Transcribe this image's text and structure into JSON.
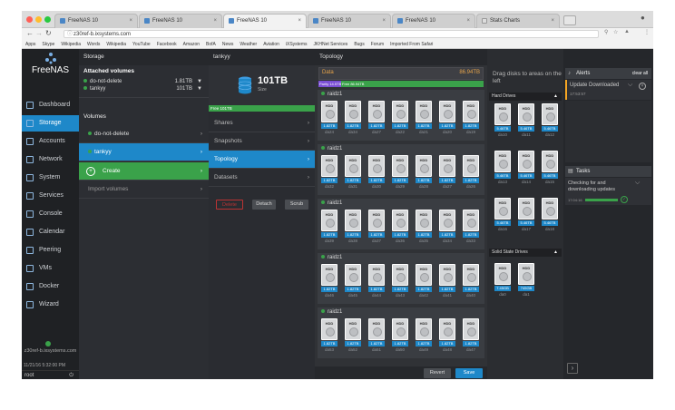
{
  "browser": {
    "tabs": [
      {
        "label": "FreeNAS 10"
      },
      {
        "label": "FreeNAS 10"
      },
      {
        "label": "FreeNAS 10"
      },
      {
        "label": "FreeNAS 10"
      },
      {
        "label": "FreeNAS 10"
      },
      {
        "label": "Stats Charts"
      }
    ],
    "url": "z30ref-b.ixsystems.com",
    "bookmarks": [
      "Apps",
      "Skype",
      "Wikipedia",
      "Words",
      "Wikipedia",
      "YouTube",
      "Facebook",
      "Amazon",
      "BofA",
      "News",
      "Weather",
      "Aviation",
      "iXSystems",
      "JKHNet Services",
      "Bugs",
      "Forum",
      "Imported From Safari"
    ]
  },
  "sidebar": {
    "logo": "FreeNAS",
    "items": [
      {
        "label": "Dashboard",
        "icon": "dashboard-icon"
      },
      {
        "label": "Storage",
        "icon": "storage-icon"
      },
      {
        "label": "Accounts",
        "icon": "accounts-icon"
      },
      {
        "label": "Network",
        "icon": "network-icon"
      },
      {
        "label": "System",
        "icon": "system-icon"
      },
      {
        "label": "Services",
        "icon": "services-icon"
      },
      {
        "label": "Console",
        "icon": "console-icon"
      },
      {
        "label": "Calendar",
        "icon": "calendar-icon"
      },
      {
        "label": "Peering",
        "icon": "peering-icon"
      },
      {
        "label": "VMs",
        "icon": "vms-icon"
      },
      {
        "label": "Docker",
        "icon": "docker-icon"
      },
      {
        "label": "Wizard",
        "icon": "wizard-icon"
      }
    ],
    "host": "z30ref-b.ixsystems.com",
    "datetime": "11/21/16 5:32:00 PM",
    "user": "root"
  },
  "storage": {
    "title": "Storage",
    "attached_title": "Attached volumes",
    "attached": [
      {
        "name": "do-not-delete",
        "size": "1.81TB"
      },
      {
        "name": "tankyy",
        "size": "101TB"
      }
    ],
    "volumes_title": "Volumes",
    "volumes": [
      "do-not-delete",
      "tankyy"
    ],
    "create_label": "Create",
    "import_label": "Import volumes"
  },
  "pool": {
    "name": "tankyy",
    "size": "101TB",
    "size_caption": "Size",
    "free": "Free 101TB",
    "menu": [
      "Shares",
      "Snapshots",
      "Topology",
      "Datasets"
    ],
    "buttons": {
      "delete": "Delete",
      "detach": "Detach",
      "scrub": "Scrub"
    }
  },
  "topology": {
    "title": "Topology",
    "data_label": "Data",
    "data_size": "86.94TB",
    "parity": "Parity 14.5TB",
    "free": "Free 86.94TB",
    "disk_type": "HDD",
    "vdevs": [
      {
        "label": "raidz1",
        "disks": [
          [
            "1.82TB",
            "da24"
          ],
          [
            "1.82TB",
            "da34"
          ],
          [
            "1.82TB",
            "da27"
          ],
          [
            "1.82TB",
            "da22"
          ],
          [
            "1.82TB",
            "da21"
          ],
          [
            "1.82TB",
            "da20"
          ],
          [
            "1.82TB",
            "da19"
          ]
        ]
      },
      {
        "label": "raidz1",
        "disks": [
          [
            "1.82TB",
            "da32"
          ],
          [
            "1.82TB",
            "da31"
          ],
          [
            "1.82TB",
            "da30"
          ],
          [
            "1.82TB",
            "da29"
          ],
          [
            "1.82TB",
            "da28"
          ],
          [
            "1.82TB",
            "da27"
          ],
          [
            "1.82TB",
            "da26"
          ]
        ]
      },
      {
        "label": "raidz1",
        "disks": [
          [
            "1.82TB",
            "da39"
          ],
          [
            "1.82TB",
            "da38"
          ],
          [
            "1.82TB",
            "da37"
          ],
          [
            "1.82TB",
            "da36"
          ],
          [
            "1.82TB",
            "da35"
          ],
          [
            "1.82TB",
            "da34"
          ],
          [
            "1.82TB",
            "da33"
          ]
        ]
      },
      {
        "label": "raidz1",
        "disks": [
          [
            "1.82TB",
            "da46"
          ],
          [
            "1.82TB",
            "da45"
          ],
          [
            "1.82TB",
            "da44"
          ],
          [
            "1.82TB",
            "da43"
          ],
          [
            "1.82TB",
            "da42"
          ],
          [
            "1.82TB",
            "da41"
          ],
          [
            "1.82TB",
            "da40"
          ]
        ]
      },
      {
        "label": "raidz1",
        "disks": [
          [
            "1.82TB",
            "da53"
          ],
          [
            "1.82TB",
            "da52"
          ],
          [
            "1.82TB",
            "da51"
          ],
          [
            "1.82TB",
            "da50"
          ],
          [
            "1.82TB",
            "da49"
          ],
          [
            "1.82TB",
            "da48"
          ],
          [
            "1.82TB",
            "da47"
          ]
        ]
      }
    ],
    "revert_label": "Revert",
    "save_label": "Save"
  },
  "disks": {
    "hint": "Drag disks to areas on the left",
    "hard_drives_title": "Hard Drives",
    "hard_drives": [
      [
        "5.46TB",
        "da10"
      ],
      [
        "5.46TB",
        "da11"
      ],
      [
        "5.46TB",
        "da12"
      ],
      [
        "5.46TB",
        "da13"
      ],
      [
        "5.46TB",
        "da14"
      ],
      [
        "5.46TB",
        "da15"
      ],
      [
        "5.46TB",
        "da16"
      ],
      [
        "5.46TB",
        "da17"
      ],
      [
        "5.46TB",
        "da18"
      ]
    ],
    "ssd_title": "Solid State Drives",
    "ssd": [
      [
        "7.45GB",
        "da0"
      ],
      [
        "745GB",
        "da1"
      ]
    ]
  },
  "alerts": {
    "title": "Alerts",
    "clear_all": "clear all",
    "message": "Update Downloaded",
    "time": "17:53:57"
  },
  "tasks": {
    "title": "Tasks",
    "message": "Checking for and downloading updates",
    "time": "17:04:16",
    "progress": 1.0
  },
  "colors": {
    "accent": "#1e88c9",
    "success": "#3aa24a",
    "warning": "#f5a623",
    "data": "#e6a34a",
    "parity": "#7b4fd6"
  }
}
